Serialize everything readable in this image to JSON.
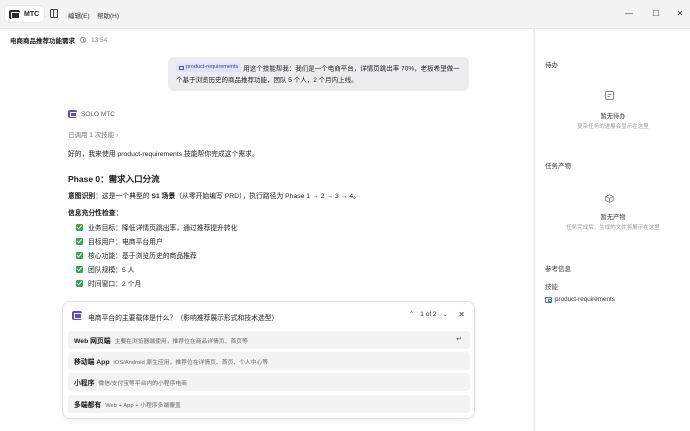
{
  "app": {
    "name": "MTC"
  },
  "menu": [
    "编辑(E)",
    "帮助(H)"
  ],
  "window_controls": {
    "minimize": "—",
    "maximize": "☐",
    "close": "✕"
  },
  "conversation": {
    "title": "电商商品推荐功能需求",
    "time": "13:54",
    "user_message": {
      "skill": "product-requirements",
      "line1": "用这个技能帮我：我们是一个电商平台，详情页跳出率 70%，老板希望做一",
      "line2": "个基于浏览历史的商品推荐功能，团队 5 个人，2 个月内上线。"
    },
    "agent_name": "SOLO MTC",
    "used_skills": "已调用 1 次技能",
    "used_skills_chevron": "›",
    "intro": "好的，我来使用 product-requirements 技能帮你完成这个需求。",
    "phase_title": "Phase 0：需求入口分流",
    "intent_label": "意图识别",
    "intent_text": "：这是一个典型的 ",
    "intent_scene": "S1 场景",
    "intent_rest": "（从零开始编写 PRD），执行路径为 Phase 1 → 2 → 3 → 4。",
    "info_title": "信息充分性检查：",
    "checks": [
      "业务目标：降低详情页跳出率，通过推荐提升转化",
      "目标用户：电商平台用户",
      "核心功能：基于浏览历史的商品推荐",
      "团队规模：5 人",
      "时间窗口：2 个月"
    ]
  },
  "question": {
    "text": "电商平台的主要载体是什么？（影响推荐展示形式和技术选型）",
    "page": "1 of 2",
    "up": "⌃",
    "down": "⌄",
    "close": "✕",
    "enter": "↵",
    "options": [
      {
        "title": "Web 网页端",
        "desc": "主要在浏览器端使用，推荐位在商品详情页、首页等"
      },
      {
        "title": "移动端 App",
        "desc": "iOS/Android 原生应用，推荐位在详情页、首页、个人中心等"
      },
      {
        "title": "小程序",
        "desc": "微信/支付宝等平台内的小程序电商"
      },
      {
        "title": "多端都有",
        "desc": "Web + App + 小程序多端覆盖"
      }
    ]
  },
  "side_panel": {
    "todo": {
      "title": "待办",
      "empty_title": "暂无待办",
      "empty_sub": "复杂任务的进展会显示在这里"
    },
    "artifacts": {
      "title": "任务产物",
      "empty_title": "暂无产物",
      "empty_sub": "任务完成后，生成的文件将展示在这里"
    },
    "reference": {
      "title": "参考信息",
      "skills_label": "技能",
      "skill_item": "product-requirements"
    }
  },
  "colors": {
    "accent": "#6146d9",
    "check": "#2fa84f",
    "chip_bg": "#dde3f7",
    "bubble_bg": "#ececee"
  }
}
